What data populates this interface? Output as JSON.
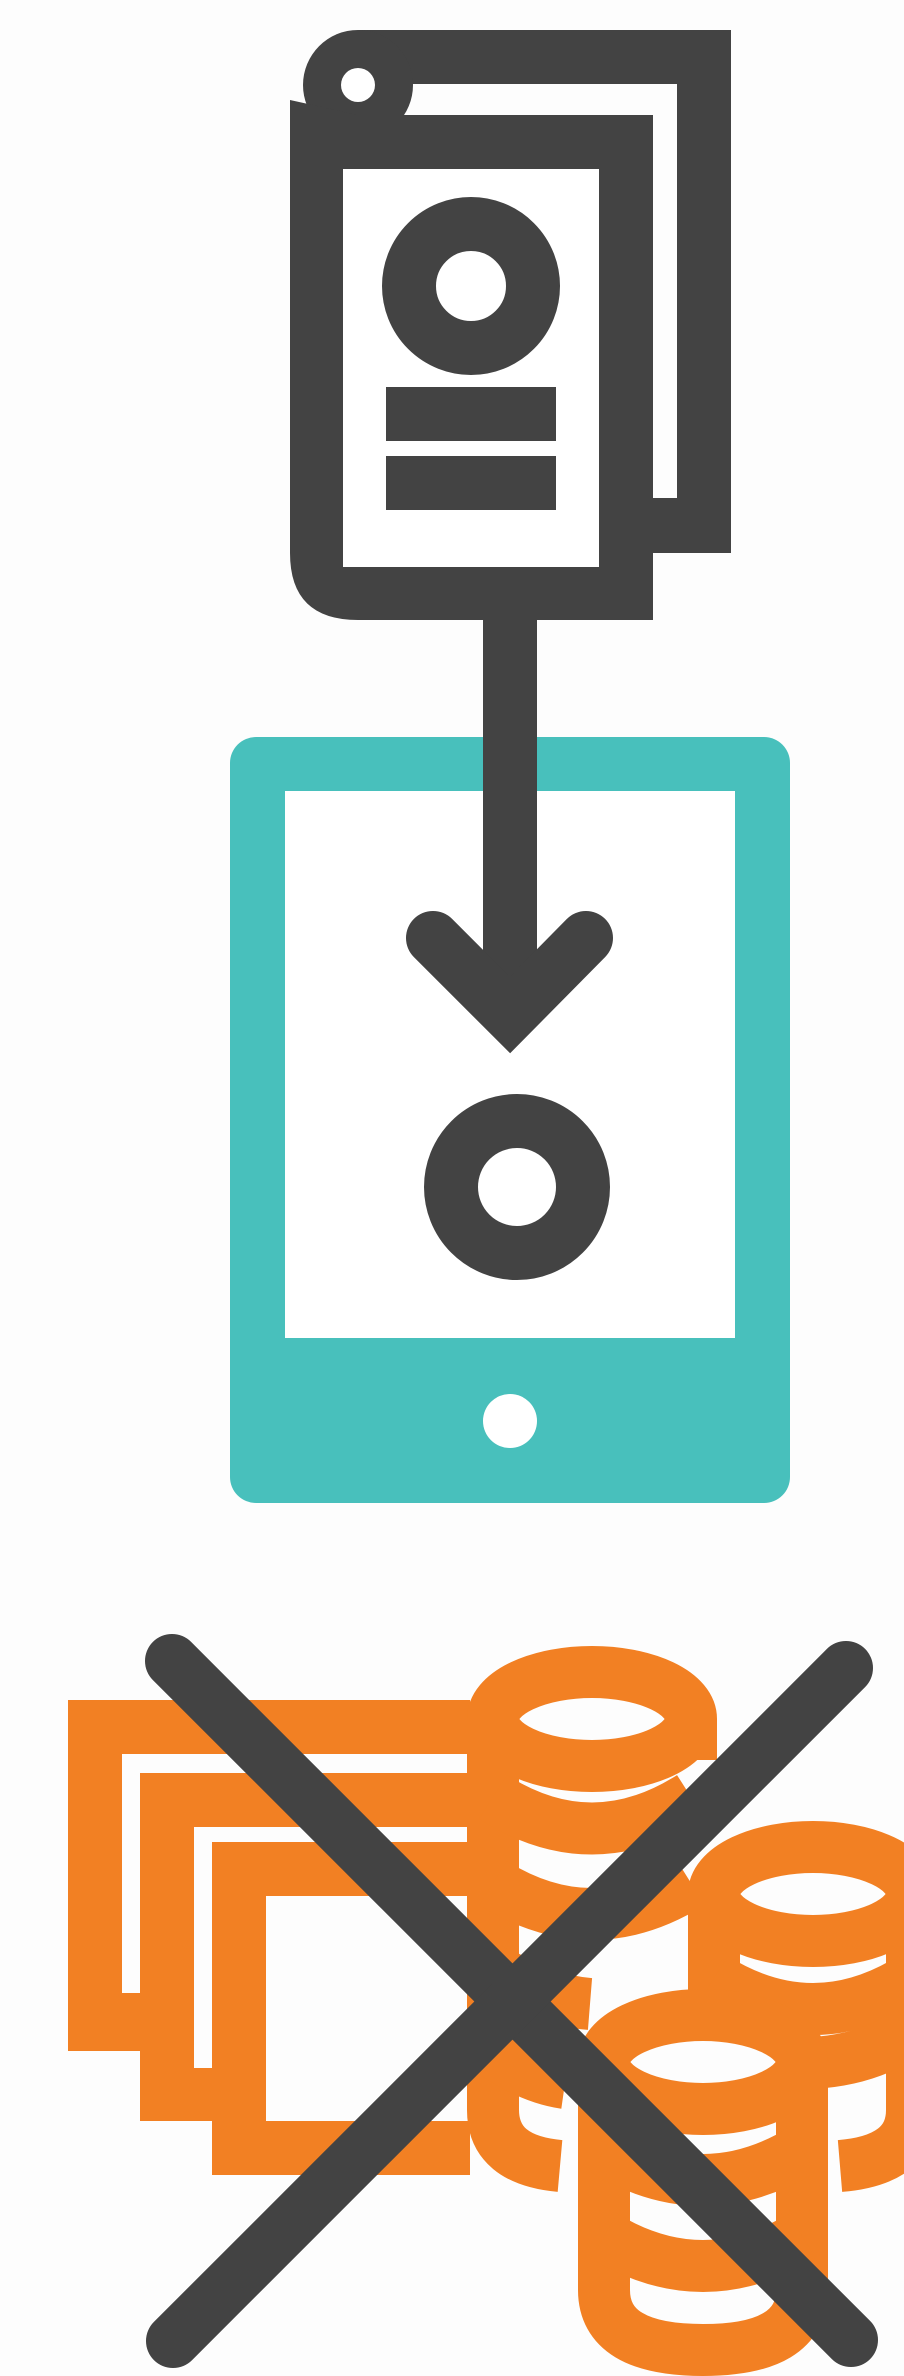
{
  "illustration": {
    "colors": {
      "dark": "#434343",
      "teal": "#48c0bc",
      "orange": "#f28023",
      "white": "#ffffff",
      "background": "#fdfdfd"
    },
    "icons": [
      "id-card-document-icon",
      "down-arrow-icon",
      "tablet-device-icon",
      "bills-icon",
      "coin-stacks-icon",
      "cross-mark-icon"
    ]
  }
}
